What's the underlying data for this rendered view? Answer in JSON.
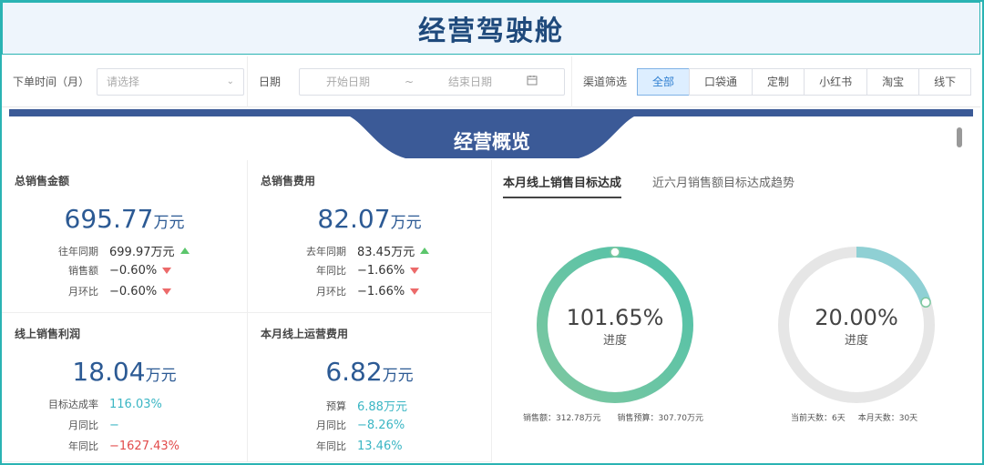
{
  "header": {
    "title": "经营驾驶舱"
  },
  "filters": {
    "order_time_label": "下单时间（月）",
    "order_time_placeholder": "请选择",
    "date_label": "日期",
    "date_start_placeholder": "开始日期",
    "date_sep": "~",
    "date_end_placeholder": "结束日期",
    "channel_label": "渠道筛选",
    "channels": [
      "全部",
      "口袋通",
      "定制",
      "小红书",
      "淘宝",
      "线下"
    ],
    "active_channel": "全部"
  },
  "section": {
    "title": "经营概览"
  },
  "cards": [
    {
      "title": "总销售金额",
      "value": "695.77",
      "unit": "万元",
      "unit_tail": "元",
      "rows": [
        {
          "k": "往年同期",
          "v": "699.97万元",
          "trend": "up"
        },
        {
          "k": "销售额",
          "v": "−0.60%",
          "trend": "down"
        },
        {
          "k": "月环比",
          "v": "−0.60%",
          "trend": "down"
        }
      ]
    },
    {
      "title": "总销售费用",
      "value": "82.07",
      "unit": "万元",
      "rows": [
        {
          "k": "去年同期",
          "v": "83.45万元",
          "trend": "up"
        },
        {
          "k": "年同比",
          "v": "−1.66%",
          "trend": "down"
        },
        {
          "k": "月环比",
          "v": "−1.66%",
          "trend": "down"
        }
      ]
    },
    {
      "title": "线上销售利润",
      "value": "18.04",
      "unit": "万元",
      "rows": [
        {
          "k": "目标达成率",
          "v": "116.03%"
        },
        {
          "k": "月同比",
          "v": "−"
        },
        {
          "k": "年同比",
          "v": "−1627.43%"
        }
      ]
    },
    {
      "title": "本月线上运营费用",
      "value": "6.82",
      "unit": "万元",
      "rows": [
        {
          "k": "预算",
          "v": "6.88万元"
        },
        {
          "k": "月同比",
          "v": "−8.26%"
        },
        {
          "k": "年同比",
          "v": "13.46%"
        }
      ]
    }
  ],
  "right_tabs": [
    "本月线上销售目标达成",
    "近六月销售额目标达成趋势"
  ],
  "gauges": [
    {
      "value": "101.65%",
      "label": "进度",
      "progress": 1.0165,
      "foot1": "销售额：312.78万元",
      "foot2": "销售预算：307.70万元"
    },
    {
      "value": "20.00%",
      "label": "进度",
      "progress": 0.2,
      "foot1": "当前天数：6天",
      "foot2": "本月天数：30天"
    }
  ],
  "colors": {
    "accent": "#3b5a97",
    "title": "#1f4a7c",
    "teal": "#3bb6c4",
    "red": "#e24b4b",
    "up": "#5cc66c",
    "down": "#ec6a6a"
  }
}
